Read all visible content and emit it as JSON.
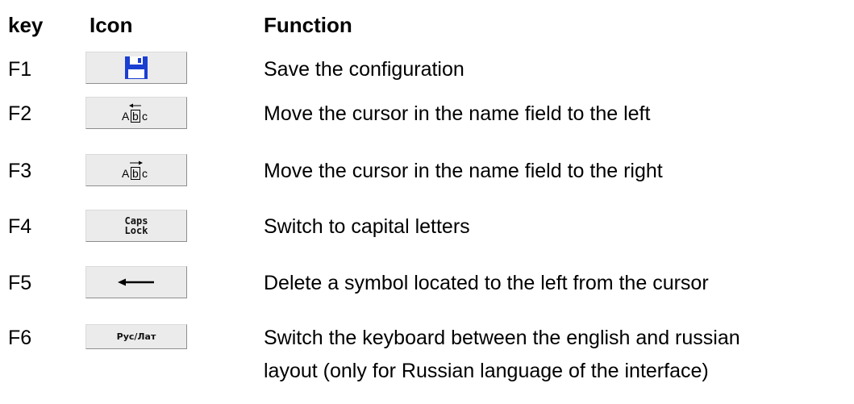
{
  "header": {
    "key": "key",
    "icon": "Icon",
    "function": "Function"
  },
  "rows": [
    {
      "key": "F1",
      "icon": "floppy-disk-icon",
      "function": "Save the configuration"
    },
    {
      "key": "F2",
      "icon": "cursor-left-icon",
      "icon_text": [
        "A",
        "b",
        "c"
      ],
      "function": "Move the cursor in the name field to the left"
    },
    {
      "key": "F3",
      "icon": "cursor-right-icon",
      "icon_text": [
        "A",
        "b",
        "c"
      ],
      "function": "Move the cursor in the name field to the right"
    },
    {
      "key": "F4",
      "icon": "caps-lock-icon",
      "icon_text": [
        "Caps",
        "Lock"
      ],
      "function": "Switch to capital letters"
    },
    {
      "key": "F5",
      "icon": "left-arrow-icon",
      "function": "Delete a symbol located to the left from the cursor"
    },
    {
      "key": "F6",
      "icon": "keyboard-layout-icon",
      "icon_text": [
        "Рус/Лат"
      ],
      "function_lines": [
        "Switch the keyboard between the english and russian",
        "layout (only for Russian language of the interface)"
      ]
    }
  ],
  "colors": {
    "button_bg": "#ebebeb",
    "floppy_blue": "#1b3fd1",
    "text": "#000000"
  }
}
